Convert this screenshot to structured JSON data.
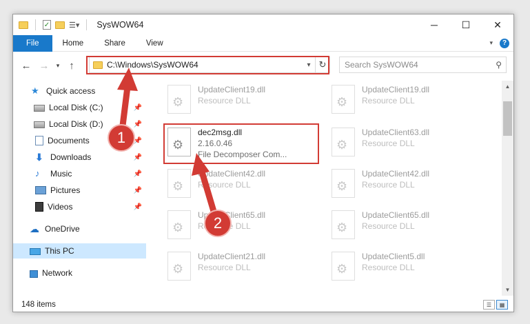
{
  "window": {
    "title": "SysWOW64",
    "controls": {
      "minimize": "─",
      "maximize": "☐",
      "close": "✕"
    }
  },
  "ribbon": {
    "tabs": [
      "File",
      "Home",
      "Share",
      "View"
    ],
    "help": "?"
  },
  "navigation": {
    "back": "←",
    "forward": "→",
    "recent": "▾",
    "up": "↑",
    "address": "C:\\Windows\\SysWOW64",
    "refresh": "↻",
    "search_placeholder": "Search SysWOW64"
  },
  "sidebar": {
    "items": [
      {
        "label": "Quick access",
        "icon": "star-icon",
        "pinned": false
      },
      {
        "label": "Local Disk (C:)",
        "icon": "disk-icon",
        "pinned": true
      },
      {
        "label": "Local Disk (D:)",
        "icon": "disk-icon",
        "pinned": true
      },
      {
        "label": "Documents",
        "icon": "documents-icon",
        "pinned": true
      },
      {
        "label": "Downloads",
        "icon": "downloads-icon",
        "pinned": true
      },
      {
        "label": "Music",
        "icon": "music-icon",
        "pinned": true
      },
      {
        "label": "Pictures",
        "icon": "pictures-icon",
        "pinned": true
      },
      {
        "label": "Videos",
        "icon": "videos-icon",
        "pinned": true
      },
      {
        "label": "OneDrive",
        "icon": "onedrive-icon",
        "pinned": false
      },
      {
        "label": "This PC",
        "icon": "this-pc-icon",
        "pinned": false,
        "selected": true
      },
      {
        "label": "Network",
        "icon": "network-icon",
        "pinned": false
      }
    ]
  },
  "files": [
    {
      "name": "UpdateClient19.dll",
      "sub1": "Resource DLL",
      "sub2": "",
      "faded": true
    },
    {
      "name": "UpdateClient19.dll",
      "sub1": "Resource DLL",
      "sub2": "",
      "faded": true
    },
    {
      "name": "dec2msg.dll",
      "sub1": "2.16.0.46",
      "sub2": "File Decomposer Com...",
      "faded": false
    },
    {
      "name": "UpdateClient63.dll",
      "sub1": "Resource DLL",
      "sub2": "",
      "faded": true
    },
    {
      "name": "UpdateClient42.dll",
      "sub1": "Resource DLL",
      "sub2": "",
      "faded": true
    },
    {
      "name": "UpdateClient42.dll",
      "sub1": "Resource DLL",
      "sub2": "",
      "faded": true
    },
    {
      "name": "UpdateClient65.dll",
      "sub1": "Resource DLL",
      "sub2": "",
      "faded": true
    },
    {
      "name": "UpdateClient65.dll",
      "sub1": "Resource DLL",
      "sub2": "",
      "faded": true
    },
    {
      "name": "UpdateClient21.dll",
      "sub1": "Resource DLL",
      "sub2": "",
      "faded": true
    },
    {
      "name": "UpdateClient5.dll",
      "sub1": "Resource DLL",
      "sub2": "",
      "faded": true
    }
  ],
  "status": {
    "items": "148 items"
  },
  "annotations": {
    "step1": "1",
    "step2": "2",
    "color": "#d23b34"
  }
}
